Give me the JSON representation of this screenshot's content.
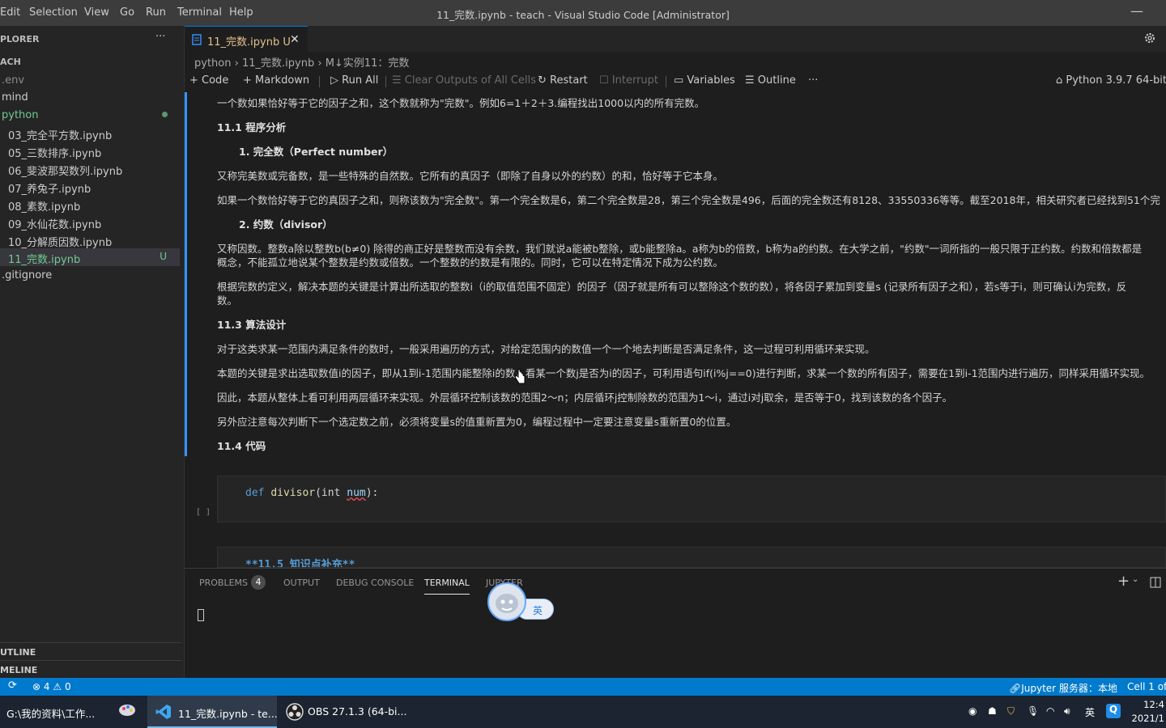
{
  "titlebar": {
    "menu": [
      "Edit",
      "Selection",
      "View",
      "Go",
      "Run",
      "Terminal",
      "Help"
    ],
    "title": "11_完数.ipynb - teach - Visual Studio Code [Administrator]"
  },
  "sidebar": {
    "explorer_title": "PLORER",
    "more": "···",
    "folder": "ACH",
    "items": [
      {
        "label": ".env"
      },
      {
        "label": "mind"
      },
      {
        "label": "python"
      },
      {
        "label": "03_完全平方数.ipynb"
      },
      {
        "label": "05_三数排序.ipynb"
      },
      {
        "label": "06_斐波那契数列.ipynb"
      },
      {
        "label": "07_养兔子.ipynb"
      },
      {
        "label": "08_素数.ipynb"
      },
      {
        "label": "09_水仙花数.ipynb"
      },
      {
        "label": "10_分解质因数.ipynb"
      },
      {
        "label": "11_完数.ipynb",
        "badge": "U"
      },
      {
        "label": ".gitignore"
      }
    ],
    "outline": "UTLINE",
    "timeline": "MELINE"
  },
  "tab": {
    "label": "11_完数.ipynb",
    "badge": "U"
  },
  "breadcrumb": {
    "folder": "python",
    "file": "11_完数.ipynb",
    "section": "M↓实例11：完数"
  },
  "toolbar": {
    "code": "Code",
    "markdown": "Markdown",
    "run_all": "Run All",
    "clear": "Clear Outputs of All Cells",
    "restart": "Restart",
    "interrupt": "Interrupt",
    "variables": "Variables",
    "outline": "Outline",
    "more": "···",
    "kernel": "Python 3.9.7 64-bit"
  },
  "notebook": {
    "intro": "一个数如果恰好等于它的因子之和，这个数就称为\"完数\"。例如6=1＋2＋3.编程找出1000以内的所有完数。",
    "h_analysis": "11.1 程序分析",
    "h_perfect": "1. 完全数（Perfect number）",
    "p_perfect": "又称完美数或完备数，是一些特殊的自然数。它所有的真因子（即除了自身以外的约数）的和，恰好等于它本身。",
    "p_perfect2": "如果一个数恰好等于它的真因子之和，则称该数为\"完全数\"。第一个完全数是6，第二个完全数是28，第三个完全数是496，后面的完全数还有8128、33550336等等。截至2018年，相关研究者已经找到51个完",
    "h_divisor": "2. 约数（divisor）",
    "p_div1": "又称因数。整数a除以整数b(b≠0) 除得的商正好是整数而没有余数，我们就说a能被b整除，或b能整除a。a称为b的倍数，b称为a的约数。在大学之前，\"约数\"一词所指的一般只限于正约数。约数和倍数都是",
    "p_div2": "概念，不能孤立地说某个整数是约数或倍数。一个整数的约数是有限的。同时，它可以在特定情况下成为公约数。",
    "p_def1": "根据完数的定义，解决本题的关键是计算出所选取的整数i（i的取值范围不固定）的因子（因子就是所有可以整除这个数的数），将各因子累加到变量s (记录所有因子之和），若s等于i，则可确认i为完数，反",
    "p_def2": "数。",
    "h_algo": "11.3 算法设计",
    "p_algo1": "对于这类求某一范围内满足条件的数时，一般采用遍历的方式，对给定范围内的数值一个一个地去判断是否满足条件，这一过程可利用循环来实现。",
    "p_algo2": "本题的关键是求出选取数值i的因子，即从1到i-1范围内能整除i的数，看某一个数j是否为i的因子，可利用语句if(i%j==0)进行判断，求某一个数的所有因子，需要在1到i-1范围内进行遍历，同样采用循环实现。",
    "p_algo3": "因此，本题从整体上看可利用两层循环来实现。外层循环控制该数的范围2～n；内层循环j控制除数的范围为1～i，通过i对j取余，是否等于0，找到该数的各个因子。",
    "p_algo4": "另外应注意每次判断下一个选定数之前，必须将变量s的值重新置为0，编程过程中一定要注意变量s重新置0的位置。",
    "h_code": "11.4 代码",
    "code": {
      "kw": "def",
      "fn": "divisor",
      "open": "(int ",
      "param": "num",
      "close": "):"
    },
    "exec": "[ ]",
    "md2": "**11.5 知识点补充**"
  },
  "panel": {
    "problems": "PROBLEMS",
    "problems_count": "4",
    "output": "OUTPUT",
    "debug": "DEBUG CONSOLE",
    "terminal": "TERMINAL",
    "jupyter": "JUPYTER",
    "plus": "+"
  },
  "ime": {
    "char": "英"
  },
  "statusbar": {
    "errors": "4",
    "warnings": "0",
    "jupyter": "Jupyter 服务器：本地",
    "cell": "Cell 1 of"
  },
  "taskbar": {
    "explorer": "G:\\我的资料\\工作...",
    "vscode": "11_完数.ipynb - te...",
    "obs": "OBS 27.1.3 (64-bi...",
    "lang": "英",
    "time": "12:4",
    "date": "2021/1"
  },
  "colors": {
    "accent": "#007acc",
    "modified": "#e2c08d",
    "untracked": "#73c991"
  }
}
